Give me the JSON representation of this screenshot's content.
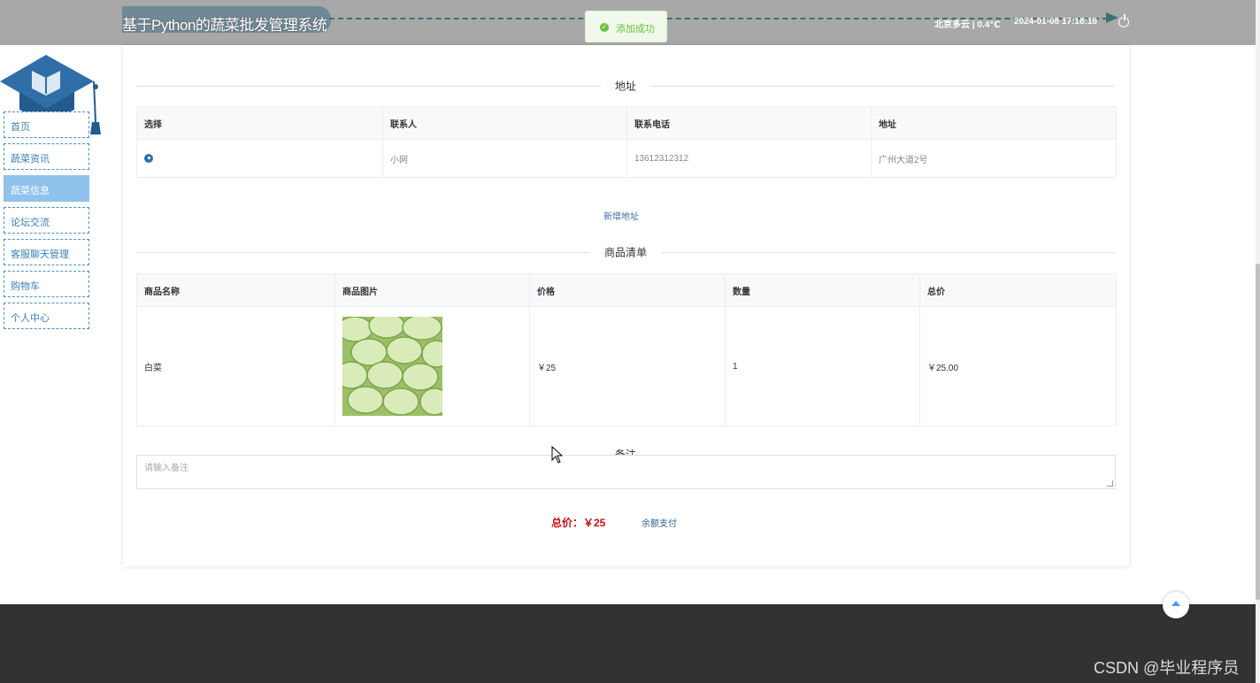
{
  "header": {
    "title": "基于Python的蔬菜批发管理系统",
    "weather": "北京多云 | 0.4℃",
    "datetime": "2024-01-08   17:18:18"
  },
  "toast": {
    "message": "添加成功"
  },
  "sidebar": {
    "items": [
      {
        "label": "首页"
      },
      {
        "label": "蔬菜资讯"
      },
      {
        "label": "蔬菜信息"
      },
      {
        "label": "论坛交流"
      },
      {
        "label": "客服聊天管理"
      },
      {
        "label": "购物车"
      },
      {
        "label": "个人中心"
      }
    ],
    "active_index": 2
  },
  "address_section": {
    "title": "地址",
    "columns": [
      "选择",
      "联系人",
      "联系电话",
      "地址"
    ],
    "rows": [
      {
        "contact": "小网",
        "phone": "13612312312",
        "address": "广州大道2号"
      }
    ],
    "add_label": "新增地址"
  },
  "goods_section": {
    "title": "商品清单",
    "columns": [
      "商品名称",
      "商品图片",
      "价格",
      "数量",
      "总价"
    ],
    "rows": [
      {
        "name": "白菜",
        "price": "￥25",
        "quantity": "1",
        "total": "￥25.00"
      }
    ]
  },
  "remark": {
    "title": "备注",
    "placeholder": "请输入备注"
  },
  "summary": {
    "total": "总价：￥25",
    "pay_label": "余额支付"
  },
  "watermark": "CSDN @毕业程序员",
  "colors": {
    "accent": "#3a6fa5",
    "sidebar_active": "#8fc3ec",
    "price_red": "#c0121a",
    "success": "#67c23a"
  }
}
